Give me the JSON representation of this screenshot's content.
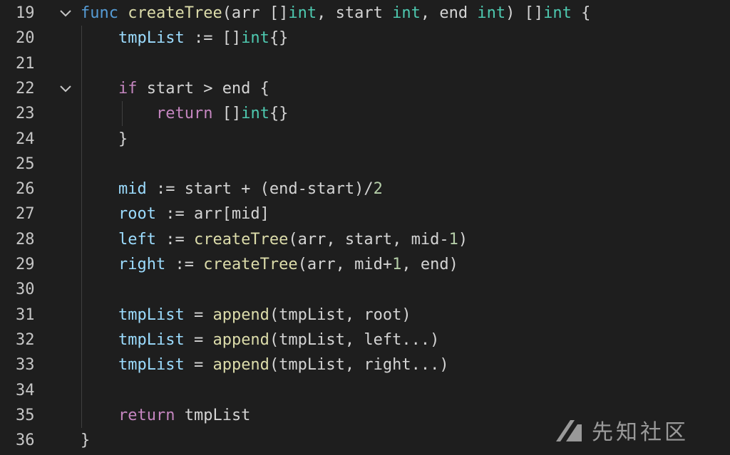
{
  "editor": {
    "colors": {
      "background": "#1e1e1e",
      "line_number": "#c6c6c6",
      "keyword_control": "#c586c0",
      "keyword_func": "#569cd6",
      "function": "#dcdcaa",
      "type": "#4ec9b0",
      "variable": "#9cdcfe",
      "number": "#b5cea8",
      "plain": "#d4d4d4"
    },
    "fold_icon": "chevron-down-icon",
    "lines": [
      {
        "num": "19",
        "fold": true,
        "tokens": [
          {
            "t": "func",
            "c": "kwb"
          },
          {
            "t": " ",
            "c": "pl"
          },
          {
            "t": "createTree",
            "c": "fn"
          },
          {
            "t": "(arr []",
            "c": "pl"
          },
          {
            "t": "int",
            "c": "ty"
          },
          {
            "t": ", start ",
            "c": "pl"
          },
          {
            "t": "int",
            "c": "ty"
          },
          {
            "t": ", end ",
            "c": "pl"
          },
          {
            "t": "int",
            "c": "ty"
          },
          {
            "t": ") []",
            "c": "pl"
          },
          {
            "t": "int",
            "c": "ty"
          },
          {
            "t": " {",
            "c": "pl"
          }
        ]
      },
      {
        "num": "20",
        "fold": false,
        "tokens": [
          {
            "t": "    ",
            "c": "pl"
          },
          {
            "t": "tmpList",
            "c": "var"
          },
          {
            "t": " := []",
            "c": "pl"
          },
          {
            "t": "int",
            "c": "ty"
          },
          {
            "t": "{}",
            "c": "pl"
          }
        ]
      },
      {
        "num": "21",
        "fold": false,
        "tokens": []
      },
      {
        "num": "22",
        "fold": true,
        "tokens": [
          {
            "t": "    ",
            "c": "pl"
          },
          {
            "t": "if",
            "c": "kw"
          },
          {
            "t": " start > end {",
            "c": "pl"
          }
        ]
      },
      {
        "num": "23",
        "fold": false,
        "tokens": [
          {
            "t": "        ",
            "c": "pl"
          },
          {
            "t": "return",
            "c": "kw"
          },
          {
            "t": " []",
            "c": "pl"
          },
          {
            "t": "int",
            "c": "ty"
          },
          {
            "t": "{}",
            "c": "pl"
          }
        ]
      },
      {
        "num": "24",
        "fold": false,
        "tokens": [
          {
            "t": "    }",
            "c": "pl"
          }
        ]
      },
      {
        "num": "25",
        "fold": false,
        "tokens": []
      },
      {
        "num": "26",
        "fold": false,
        "tokens": [
          {
            "t": "    ",
            "c": "pl"
          },
          {
            "t": "mid",
            "c": "var"
          },
          {
            "t": " := start + (end-start)/",
            "c": "pl"
          },
          {
            "t": "2",
            "c": "num"
          }
        ]
      },
      {
        "num": "27",
        "fold": false,
        "tokens": [
          {
            "t": "    ",
            "c": "pl"
          },
          {
            "t": "root",
            "c": "var"
          },
          {
            "t": " := arr[mid]",
            "c": "pl"
          }
        ]
      },
      {
        "num": "28",
        "fold": false,
        "tokens": [
          {
            "t": "    ",
            "c": "pl"
          },
          {
            "t": "left",
            "c": "var"
          },
          {
            "t": " := ",
            "c": "pl"
          },
          {
            "t": "createTree",
            "c": "fn"
          },
          {
            "t": "(arr, start, mid-",
            "c": "pl"
          },
          {
            "t": "1",
            "c": "num"
          },
          {
            "t": ")",
            "c": "pl"
          }
        ]
      },
      {
        "num": "29",
        "fold": false,
        "tokens": [
          {
            "t": "    ",
            "c": "pl"
          },
          {
            "t": "right",
            "c": "var"
          },
          {
            "t": " := ",
            "c": "pl"
          },
          {
            "t": "createTree",
            "c": "fn"
          },
          {
            "t": "(arr, mid+",
            "c": "pl"
          },
          {
            "t": "1",
            "c": "num"
          },
          {
            "t": ", end)",
            "c": "pl"
          }
        ]
      },
      {
        "num": "30",
        "fold": false,
        "tokens": []
      },
      {
        "num": "31",
        "fold": false,
        "tokens": [
          {
            "t": "    ",
            "c": "pl"
          },
          {
            "t": "tmpList",
            "c": "var"
          },
          {
            "t": " = ",
            "c": "pl"
          },
          {
            "t": "append",
            "c": "fn"
          },
          {
            "t": "(tmpList, root)",
            "c": "pl"
          }
        ]
      },
      {
        "num": "32",
        "fold": false,
        "tokens": [
          {
            "t": "    ",
            "c": "pl"
          },
          {
            "t": "tmpList",
            "c": "var"
          },
          {
            "t": " = ",
            "c": "pl"
          },
          {
            "t": "append",
            "c": "fn"
          },
          {
            "t": "(tmpList, left...)",
            "c": "pl"
          }
        ]
      },
      {
        "num": "33",
        "fold": false,
        "tokens": [
          {
            "t": "    ",
            "c": "pl"
          },
          {
            "t": "tmpList",
            "c": "var"
          },
          {
            "t": " = ",
            "c": "pl"
          },
          {
            "t": "append",
            "c": "fn"
          },
          {
            "t": "(tmpList, right...)",
            "c": "pl"
          }
        ]
      },
      {
        "num": "34",
        "fold": false,
        "tokens": []
      },
      {
        "num": "35",
        "fold": false,
        "tokens": [
          {
            "t": "    ",
            "c": "pl"
          },
          {
            "t": "return",
            "c": "kw"
          },
          {
            "t": " tmpList",
            "c": "pl"
          }
        ]
      },
      {
        "num": "36",
        "fold": false,
        "tokens": [
          {
            "t": "}",
            "c": "pl"
          }
        ]
      }
    ]
  },
  "watermark": {
    "text": "先知社区",
    "icon": "xianzhi-logo-icon"
  }
}
